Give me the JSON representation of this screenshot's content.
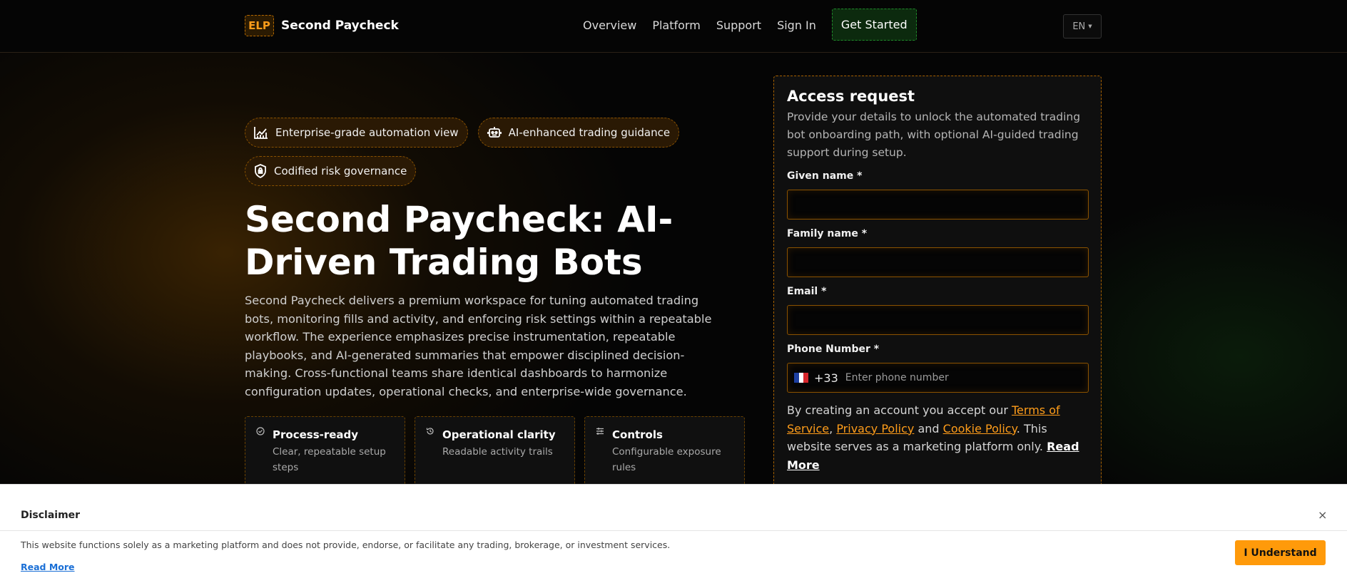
{
  "header": {
    "logo_badge": "ELP",
    "brand": "Second Paycheck",
    "nav": [
      "Overview",
      "Platform",
      "Support",
      "Sign In"
    ],
    "cta": "Get Started",
    "language": "EN"
  },
  "hero": {
    "pills": [
      {
        "label": "Enterprise-grade automation view",
        "icon": "chart-line-icon"
      },
      {
        "label": "AI-enhanced trading guidance",
        "icon": "robot-icon"
      },
      {
        "label": "Codified risk governance",
        "icon": "shield-lock-icon"
      }
    ],
    "title": "Second Paycheck: AI-Driven Trading Bots",
    "description": "Second Paycheck delivers a premium workspace for tuning automated trading bots, monitoring fills and activity, and enforcing risk settings within a repeatable workflow. The experience emphasizes precise instrumentation, repeatable playbooks, and AI-generated summaries that empower disciplined decision-making. Cross-functional teams share identical dashboards to harmonize configuration updates, operational checks, and enterprise-wide governance.",
    "features": [
      {
        "title": "Process-ready",
        "desc": "Clear, repeatable setup steps",
        "icon": "check-circle-icon"
      },
      {
        "title": "Operational clarity",
        "desc": "Readable activity trails",
        "icon": "history-icon"
      },
      {
        "title": "Controls",
        "desc": "Configurable exposure rules",
        "icon": "sliders-icon"
      }
    ]
  },
  "form": {
    "title": "Access request",
    "subtitle": "Provide your details to unlock the automated trading bot onboarding path, with optional AI-guided trading support during setup.",
    "given_name_label": "Given name *",
    "family_name_label": "Family name *",
    "email_label": "Email *",
    "phone_label": "Phone Number *",
    "dial_code": "+33",
    "phone_placeholder": "Enter phone number",
    "terms_prefix": "By creating an account you accept our ",
    "terms_link": "Terms of Service",
    "sep1": ", ",
    "privacy_link": "Privacy Policy",
    "and": " and ",
    "cookie_link": "Cookie Policy",
    "terms_suffix": ". This website serves as a marketing platform only. ",
    "read_more": "Read More"
  },
  "disclaimer": {
    "title": "Disclaimer",
    "close": "×",
    "text": "This website functions solely as a marketing platform and does not provide, endorse, or facilitate any trading, brokerage, or investment services.",
    "read_more": "Read More",
    "button": "I Understand"
  },
  "colors": {
    "accent": "#ff9d1a",
    "green": "#1f8a2a",
    "background": "#050505"
  }
}
